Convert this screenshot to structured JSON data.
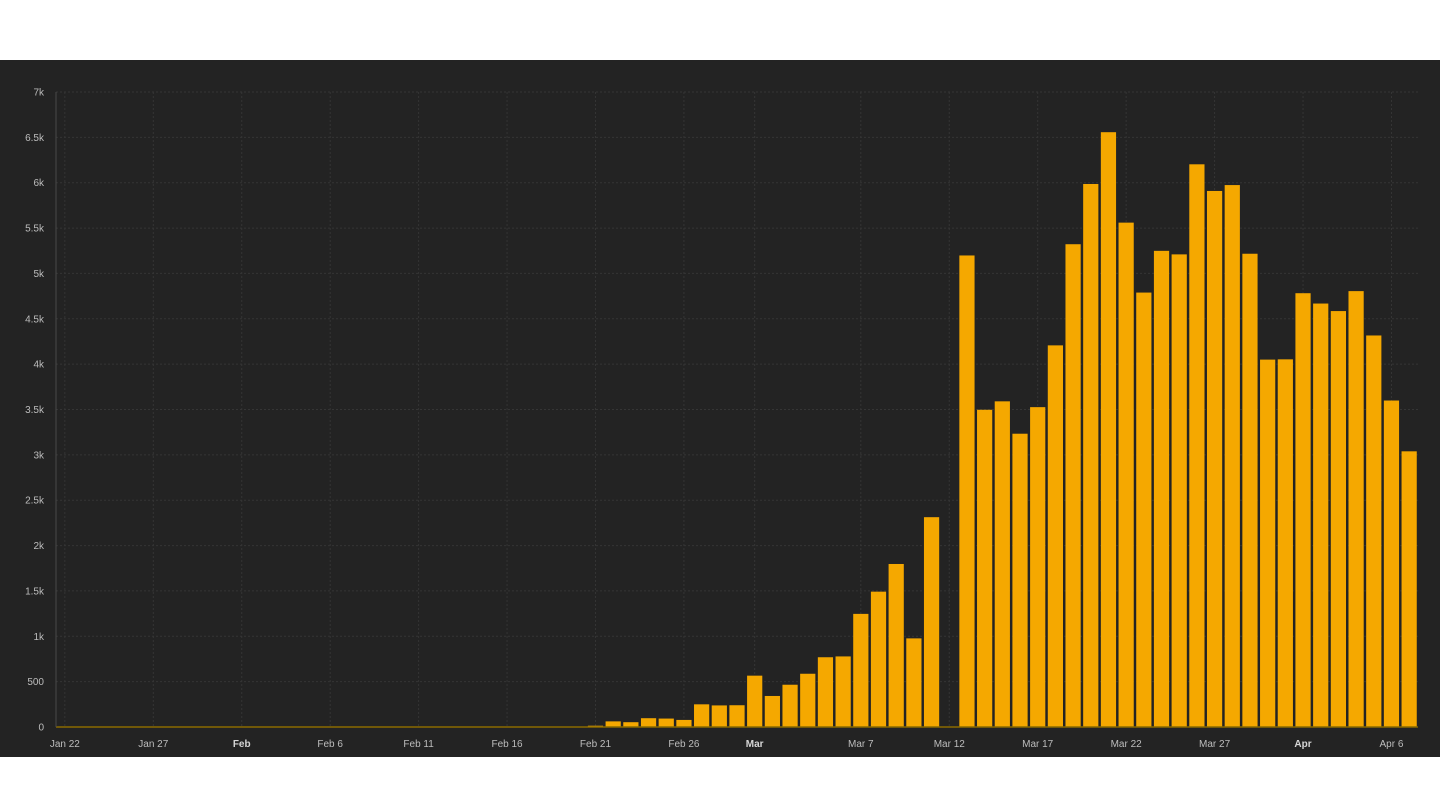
{
  "colors": {
    "background": "#232323",
    "bar": "#f5a800",
    "grid": "#353535",
    "axis": "#8a6a00",
    "tick_text": "#bdbdbd"
  },
  "chart_data": {
    "type": "bar",
    "title": "",
    "xlabel": "",
    "ylabel": "",
    "ylim": [
      0,
      7000
    ],
    "grid": true,
    "yticks": [
      0,
      500,
      1000,
      1500,
      2000,
      2500,
      3000,
      3500,
      4000,
      4500,
      5000,
      5500,
      6000,
      6500,
      7000
    ],
    "ytick_labels": [
      "0",
      "500",
      "1k",
      "1.5k",
      "2k",
      "2.5k",
      "3k",
      "3.5k",
      "4k",
      "4.5k",
      "5k",
      "5.5k",
      "6k",
      "6.5k",
      "7k"
    ],
    "x_ticks": [
      {
        "date": "2020-01-22",
        "label": "Jan 22",
        "bold": false
      },
      {
        "date": "2020-01-27",
        "label": "Jan 27",
        "bold": false
      },
      {
        "date": "2020-02-01",
        "label": "Feb",
        "bold": true
      },
      {
        "date": "2020-02-06",
        "label": "Feb 6",
        "bold": false
      },
      {
        "date": "2020-02-11",
        "label": "Feb 11",
        "bold": false
      },
      {
        "date": "2020-02-16",
        "label": "Feb 16",
        "bold": false
      },
      {
        "date": "2020-02-21",
        "label": "Feb 21",
        "bold": false
      },
      {
        "date": "2020-02-26",
        "label": "Feb 26",
        "bold": false
      },
      {
        "date": "2020-03-01",
        "label": "Mar",
        "bold": true
      },
      {
        "date": "2020-03-07",
        "label": "Mar 7",
        "bold": false
      },
      {
        "date": "2020-03-12",
        "label": "Mar 12",
        "bold": false
      },
      {
        "date": "2020-03-17",
        "label": "Mar 17",
        "bold": false
      },
      {
        "date": "2020-03-22",
        "label": "Mar 22",
        "bold": false
      },
      {
        "date": "2020-03-27",
        "label": "Mar 27",
        "bold": false
      },
      {
        "date": "2020-04-01",
        "label": "Apr",
        "bold": true
      },
      {
        "date": "2020-04-06",
        "label": "Apr 6",
        "bold": false
      }
    ],
    "x": [
      "2020-01-22",
      "2020-01-23",
      "2020-01-24",
      "2020-01-25",
      "2020-01-26",
      "2020-01-27",
      "2020-01-28",
      "2020-01-29",
      "2020-01-30",
      "2020-01-31",
      "2020-02-01",
      "2020-02-02",
      "2020-02-03",
      "2020-02-04",
      "2020-02-05",
      "2020-02-06",
      "2020-02-07",
      "2020-02-08",
      "2020-02-09",
      "2020-02-10",
      "2020-02-11",
      "2020-02-12",
      "2020-02-13",
      "2020-02-14",
      "2020-02-15",
      "2020-02-16",
      "2020-02-17",
      "2020-02-18",
      "2020-02-19",
      "2020-02-20",
      "2020-02-21",
      "2020-02-22",
      "2020-02-23",
      "2020-02-24",
      "2020-02-25",
      "2020-02-26",
      "2020-02-27",
      "2020-02-28",
      "2020-02-29",
      "2020-03-01",
      "2020-03-02",
      "2020-03-03",
      "2020-03-04",
      "2020-03-05",
      "2020-03-06",
      "2020-03-07",
      "2020-03-08",
      "2020-03-09",
      "2020-03-10",
      "2020-03-11",
      "2020-03-12",
      "2020-03-13",
      "2020-03-14",
      "2020-03-15",
      "2020-03-16",
      "2020-03-17",
      "2020-03-18",
      "2020-03-19",
      "2020-03-20",
      "2020-03-21",
      "2020-03-22",
      "2020-03-23",
      "2020-03-24",
      "2020-03-25",
      "2020-03-26",
      "2020-03-27",
      "2020-03-28",
      "2020-03-29",
      "2020-03-30",
      "2020-03-31",
      "2020-04-01",
      "2020-04-02",
      "2020-04-03",
      "2020-04-04",
      "2020-04-05",
      "2020-04-06",
      "2020-04-07"
    ],
    "values": [
      0,
      0,
      0,
      0,
      0,
      0,
      0,
      0,
      0,
      0,
      0,
      0,
      0,
      0,
      0,
      0,
      0,
      0,
      0,
      0,
      0,
      0,
      0,
      0,
      0,
      0,
      0,
      0,
      0,
      0,
      14,
      62,
      53,
      97,
      93,
      78,
      250,
      238,
      240,
      566,
      342,
      466,
      587,
      769,
      778,
      1247,
      1492,
      1797,
      977,
      2313,
      0,
      5198,
      3497,
      3590,
      3233,
      3526,
      4207,
      5322,
      5986,
      6557,
      5560,
      4789,
      5249,
      5210,
      6203,
      5909,
      5974,
      5217,
      4050,
      4053,
      4782,
      4668,
      4585,
      4805,
      4316,
      3599,
      3039
    ]
  }
}
